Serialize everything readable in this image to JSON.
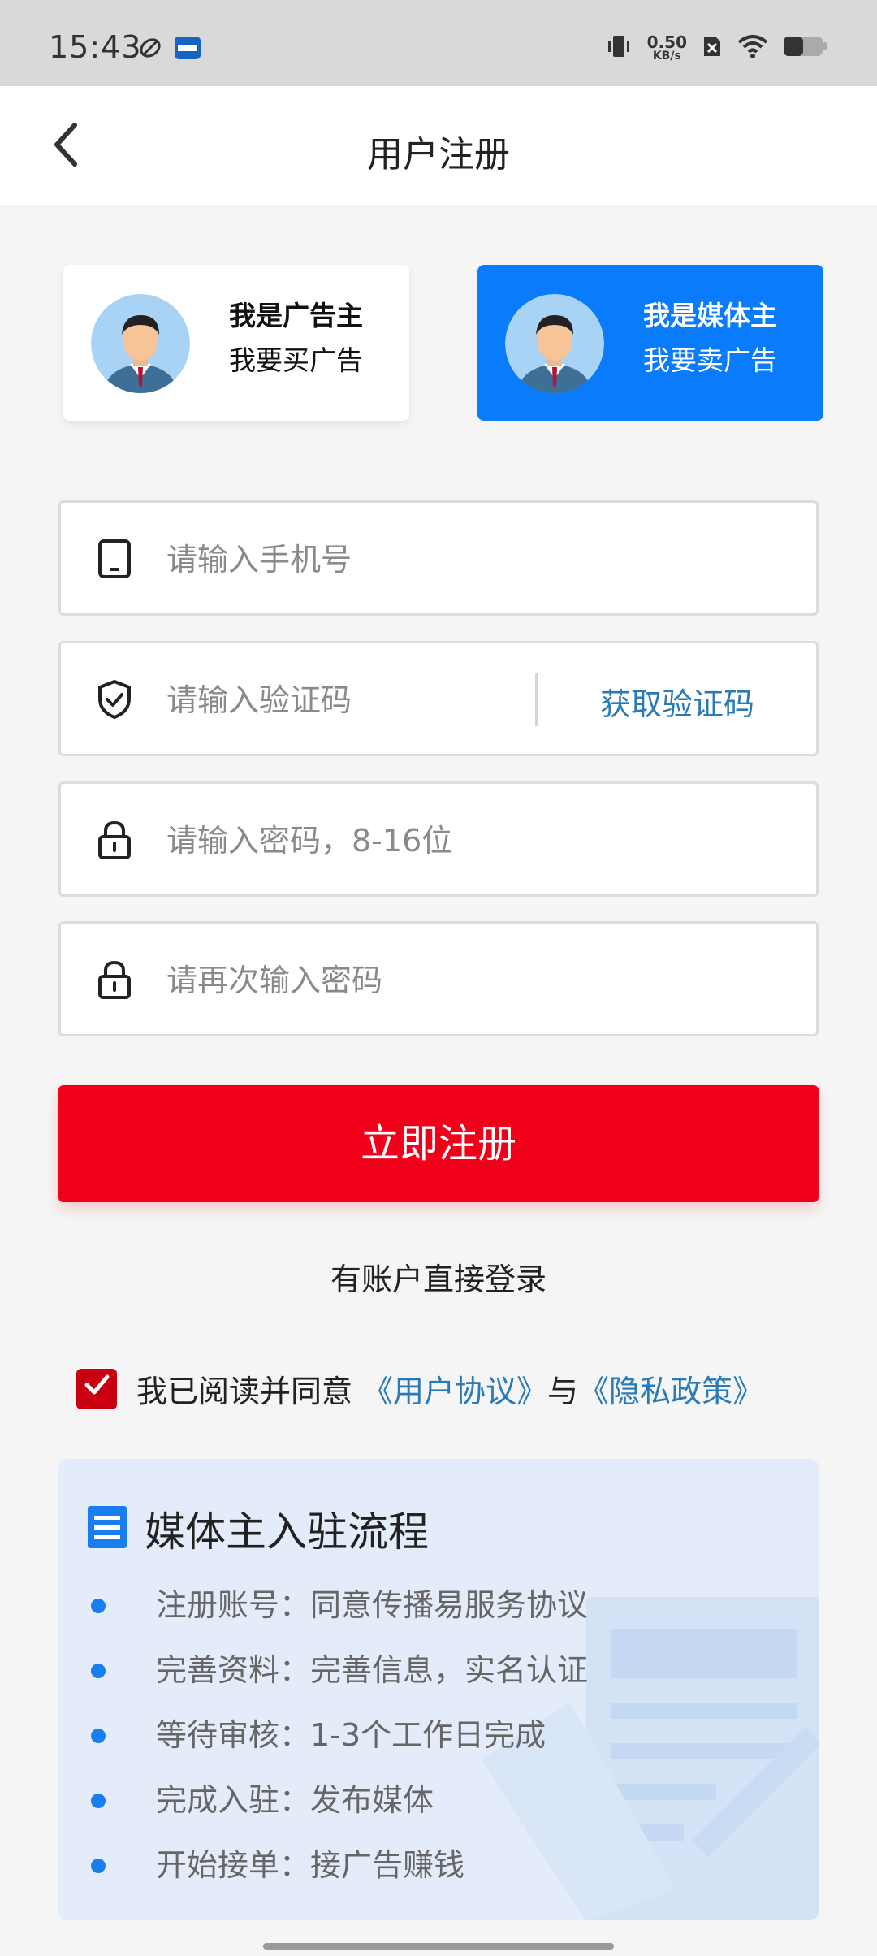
{
  "status_bar": {
    "time": "15:43",
    "net_speed_value": "0.50",
    "net_speed_unit": "KB/s"
  },
  "header": {
    "title": "用户注册"
  },
  "roles": {
    "advertiser": {
      "title": "我是广告主",
      "subtitle": "我要买广告"
    },
    "media": {
      "title": "我是媒体主",
      "subtitle": "我要卖广告"
    }
  },
  "form": {
    "phone": {
      "placeholder": "请输入手机号",
      "value": ""
    },
    "code": {
      "placeholder": "请输入验证码",
      "value": "",
      "get_code_label": "获取验证码"
    },
    "password": {
      "placeholder": "请输入密码，8-16位",
      "value": ""
    },
    "confirm_password": {
      "placeholder": "请再次输入密码",
      "value": ""
    }
  },
  "actions": {
    "register_label": "立即注册",
    "login_link": "有账户直接登录"
  },
  "agreement": {
    "checked": true,
    "prefix": "我已阅读并同意",
    "user_agreement": "《用户协议》",
    "joiner": "与",
    "privacy_policy": "《隐私政策》"
  },
  "process": {
    "title": "媒体主入驻流程",
    "steps": [
      "注册账号：同意传播易服务协议",
      "完善资料：完善信息，实名认证",
      "等待审核：1-3个工作日完成",
      "完成入驻：发布媒体",
      "开始接单：接广告赚钱"
    ]
  },
  "colors": {
    "accent_blue": "#0a7bfb",
    "register_red": "#f00019",
    "link_blue": "#2a7ab8",
    "checkbox_red": "#c8000f",
    "panel_bg": "#e3ecf8"
  },
  "icons": {
    "back": "chevron-left-icon",
    "phone": "phone-icon",
    "code": "shield-check-icon",
    "password": "lock-icon",
    "confirm_password": "lock-icon",
    "process": "document-list-icon",
    "checkbox": "checkmark-icon"
  }
}
